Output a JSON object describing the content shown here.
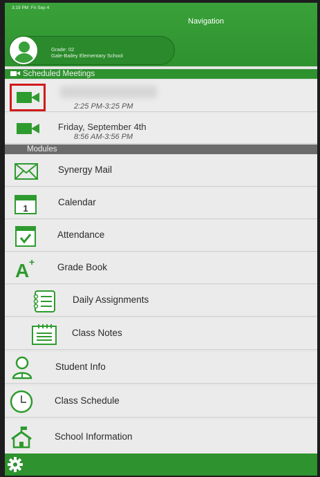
{
  "status_bar": {
    "time": "3:19 PM",
    "date": "Fri Sep 4"
  },
  "header": {
    "title": "Navigation"
  },
  "profile": {
    "grade": "Grade: 02",
    "school": "Gale-Bailey Elementary School"
  },
  "meetings": {
    "section_label": "Scheduled Meetings",
    "items": [
      {
        "date": "",
        "time": "2:25 PM-3:25 PM"
      },
      {
        "date": "Friday, September 4th",
        "time": "8:56 AM-3:56 PM"
      }
    ]
  },
  "modules": {
    "section_label": "Modules",
    "items": [
      {
        "label": "Synergy Mail",
        "icon": "mail-icon"
      },
      {
        "label": "Calendar",
        "icon": "calendar-icon"
      },
      {
        "label": "Attendance",
        "icon": "attendance-icon"
      },
      {
        "label": "Grade Book",
        "icon": "grade-book-icon"
      },
      {
        "label": "Daily Assignments",
        "icon": "assignments-icon"
      },
      {
        "label": "Class Notes",
        "icon": "notes-icon"
      },
      {
        "label": "Student Info",
        "icon": "student-info-icon"
      },
      {
        "label": "Class Schedule",
        "icon": "clock-icon"
      },
      {
        "label": "School Information",
        "icon": "school-icon"
      }
    ]
  },
  "calendar_icon_day": "1",
  "colors": {
    "brand_green": "#2e922e",
    "highlight_red": "#d11a1a"
  }
}
